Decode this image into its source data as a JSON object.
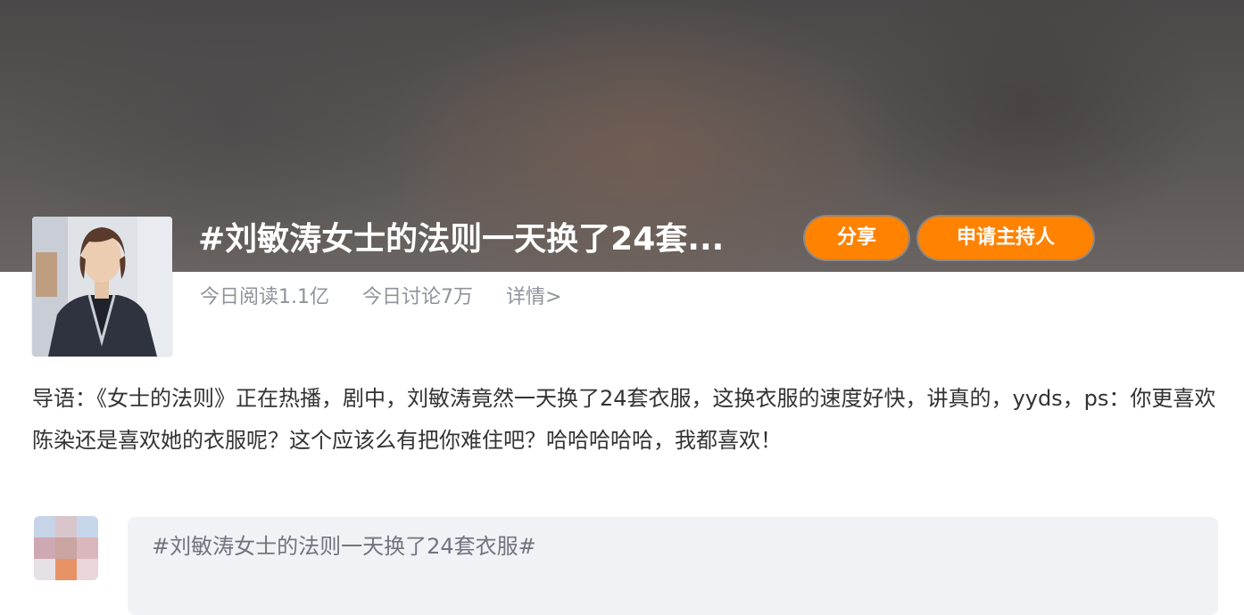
{
  "topic": {
    "title": "#刘敏涛女士的法则一天换了24套...",
    "share_label": "分享",
    "host_label": "申请主持人",
    "reads": "今日阅读1.1亿",
    "discussions": "今日讨论7万",
    "details_link": "详情>"
  },
  "intro": {
    "text": "导语：《女士的法则》正在热播，剧中，刘敏涛竟然一天换了24套衣服，这换衣服的速度好快，讲真的，yyds，ps：你更喜欢陈染还是喜欢她的衣服呢？这个应该么有把你难住吧？哈哈哈哈哈，我都喜欢！"
  },
  "compose": {
    "text": "#刘敏涛女士的法则一天换了24套衣服#"
  },
  "colors": {
    "accent": "#ff8200",
    "muted_text": "#8f939a",
    "body_text": "#333333",
    "compose_bg": "#f1f2f5"
  },
  "icons": {
    "topic_avatar": "woman-portrait",
    "user_avatar": "pixelated-avatar"
  }
}
